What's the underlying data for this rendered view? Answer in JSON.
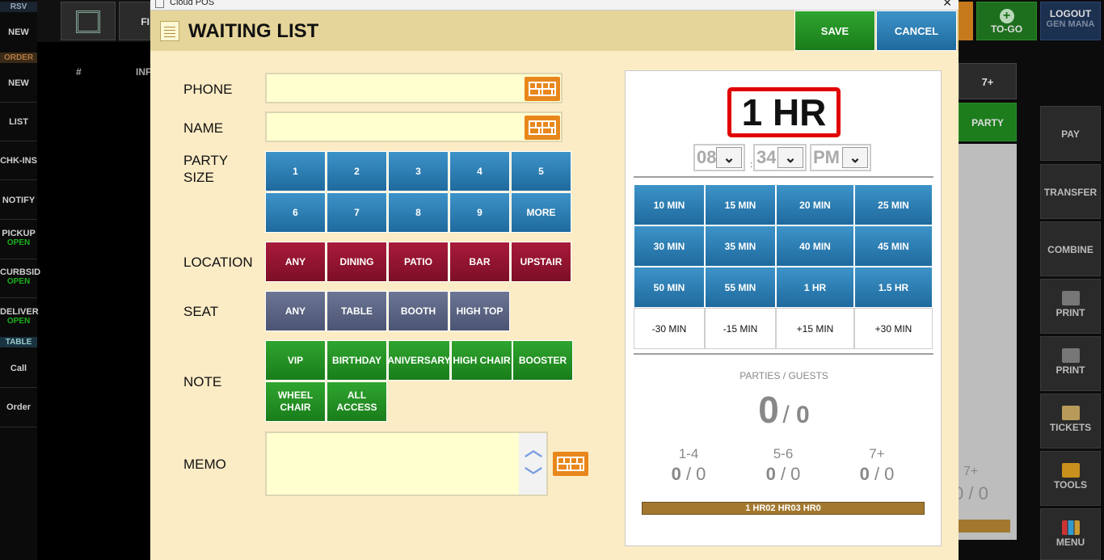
{
  "background": {
    "left": {
      "rsv": "RSV",
      "new1": "NEW",
      "order": "ORDER",
      "new2": "NEW",
      "list": "LIST",
      "chkins": "CHK-INS",
      "notify": "NOTIFY",
      "pickup": "PICKUP",
      "pickup_status": "OPEN",
      "curbside": "CURBSID",
      "curbside_status": "OPEN",
      "delivery": "DELIVER",
      "delivery_status": "OPEN",
      "table": "TABLE",
      "call": "Call",
      "order_item": "Order"
    },
    "top": {
      "fi": "FI",
      "col_num": "#",
      "col_info": "INF"
    },
    "right": {
      "togo": "TO-GO",
      "logout": "LOGOUT",
      "logout_sub": "GEN MANA",
      "seven_plus": "7+",
      "party": "PARTY",
      "pay": "PAY",
      "transfer": "TRANSFER",
      "combine": "COMBINE",
      "print1": "PRINT",
      "print2": "PRINT",
      "tickets": "TICKETS",
      "tools": "TOOLS",
      "menu": "MENU",
      "seven_plus_2": "7+",
      "zero_two": "0 / 0"
    }
  },
  "window": {
    "title": "Cloud POS",
    "close": "✕"
  },
  "dialog": {
    "title": "WAITING LIST",
    "save": "SAVE",
    "cancel": "CANCEL",
    "labels": {
      "phone": "PHONE",
      "name": "NAME",
      "party_size_1": "PARTY",
      "party_size_2": "SIZE",
      "location": "LOCATION",
      "seat": "SEAT",
      "note": "NOTE",
      "memo": "MEMO"
    },
    "phone_value": "",
    "name_value": "",
    "memo_value": "",
    "party_sizes": [
      "1",
      "2",
      "3",
      "4",
      "5",
      "6",
      "7",
      "8",
      "9",
      "MORE"
    ],
    "locations": [
      "ANY",
      "DINING",
      "PATIO",
      "BAR",
      "UPSTAIR"
    ],
    "seats": [
      "ANY",
      "TABLE",
      "BOOTH",
      "HIGH TOP"
    ],
    "notes": [
      "VIP",
      "BIRTHDAY",
      "ANIVERSARY",
      "HIGH CHAIR",
      "BOOSTER",
      "WHEEL CHAIR",
      "ALL ACCESS"
    ]
  },
  "panel": {
    "wait_time": "1 HR",
    "hour": "08",
    "minute": "34",
    "ampm": "PM",
    "colon": ":",
    "time_buttons": [
      "10 MIN",
      "15 MIN",
      "20 MIN",
      "25 MIN",
      "30 MIN",
      "35 MIN",
      "40 MIN",
      "45 MIN",
      "50 MIN",
      "55 MIN",
      "1 HR",
      "1.5 HR"
    ],
    "adjust_buttons": [
      "-30 MIN",
      "-15 MIN",
      "+15 MIN",
      "+30 MIN"
    ],
    "parties_guests_label": "PARTIES / GUESTS",
    "parties": "0",
    "guests": "0",
    "groups": [
      {
        "label": "1-4",
        "parties": "0",
        "guests": "0"
      },
      {
        "label": "5-6",
        "parties": "0",
        "guests": "0"
      },
      {
        "label": "7+",
        "parties": "0",
        "guests": "0"
      }
    ],
    "progress_text": "1 HR02 HR03 HR0"
  },
  "colors": {
    "dialog_bg": "#fcecc6",
    "header_bg": "#e6d59a",
    "save_green": "#1a7d1a",
    "cancel_blue": "#1f6a9e",
    "location_red": "#7d0e26",
    "seat_slate": "#4b5472",
    "time_red_border": "#e00000",
    "progress_brown": "#a2782f"
  }
}
